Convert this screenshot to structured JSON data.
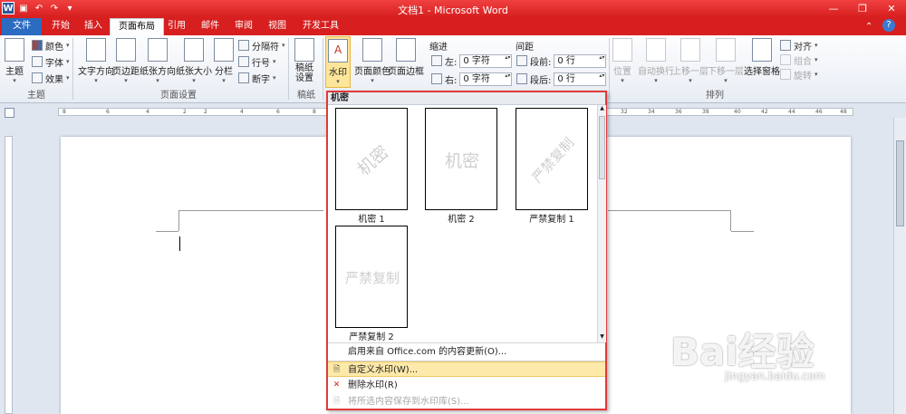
{
  "window": {
    "title": "文档1 - Microsoft Word"
  },
  "tabs": [
    "开始",
    "插入",
    "页面布局",
    "引用",
    "邮件",
    "审阅",
    "视图",
    "开发工具"
  ],
  "file_tab": "文件",
  "active_tab": "页面布局",
  "ribbon": {
    "theme_group": {
      "label": "主题",
      "theme_btn": "主题",
      "colors": "颜色",
      "fonts": "字体",
      "effects": "效果"
    },
    "page_setup_group": {
      "label": "页面设置",
      "text_direction": "文字方向",
      "margins": "页边距",
      "orientation": "纸张方向",
      "size": "纸张大小",
      "columns": "分栏",
      "breaks": "分隔符",
      "line_numbers": "行号",
      "hyphenation": "断字"
    },
    "manuscript_group": {
      "label": "稿纸",
      "manuscript": "稿纸设置"
    },
    "background_group": {
      "watermark": "水印",
      "page_color": "页面颜色",
      "page_border": "页面边框"
    },
    "indent": {
      "title": "缩进",
      "left_label": "左:",
      "left_value": "0 字符",
      "right_label": "右:",
      "right_value": "0 字符"
    },
    "spacing": {
      "title": "间距",
      "before_label": "段前:",
      "before_value": "0 行",
      "after_label": "段后:",
      "after_value": "0 行"
    },
    "arrange_group": {
      "label": "排列",
      "position": "位置",
      "wrap": "自动换行",
      "forward": "上移一层",
      "backward": "下移一层",
      "selection": "选择窗格",
      "align": "对齐",
      "group": "组合",
      "rotate": "旋转"
    }
  },
  "watermark_menu": {
    "header": "机密",
    "items": [
      {
        "preview_text": "机密",
        "label": "机密 1"
      },
      {
        "preview_text": "机密",
        "label": "机密 2"
      },
      {
        "preview_text": "严禁复制",
        "label": "严禁复制 1"
      },
      {
        "preview_text": "严禁复制",
        "label": "严禁复制 2"
      }
    ],
    "office_update": "启用来自 Office.com 的内容更新(O)...",
    "custom": "自定义水印(W)...",
    "remove": "删除水印(R)",
    "save": "将所选内容保存到水印库(S)..."
  },
  "ruler_ticks": [
    "8",
    "6",
    "4",
    "2",
    "2",
    "4",
    "6",
    "8",
    "32",
    "34",
    "36",
    "38",
    "40",
    "42",
    "44",
    "46",
    "48"
  ],
  "watermark_site": {
    "logo": "Bai经验",
    "url": "jingyan.baidu.com"
  }
}
